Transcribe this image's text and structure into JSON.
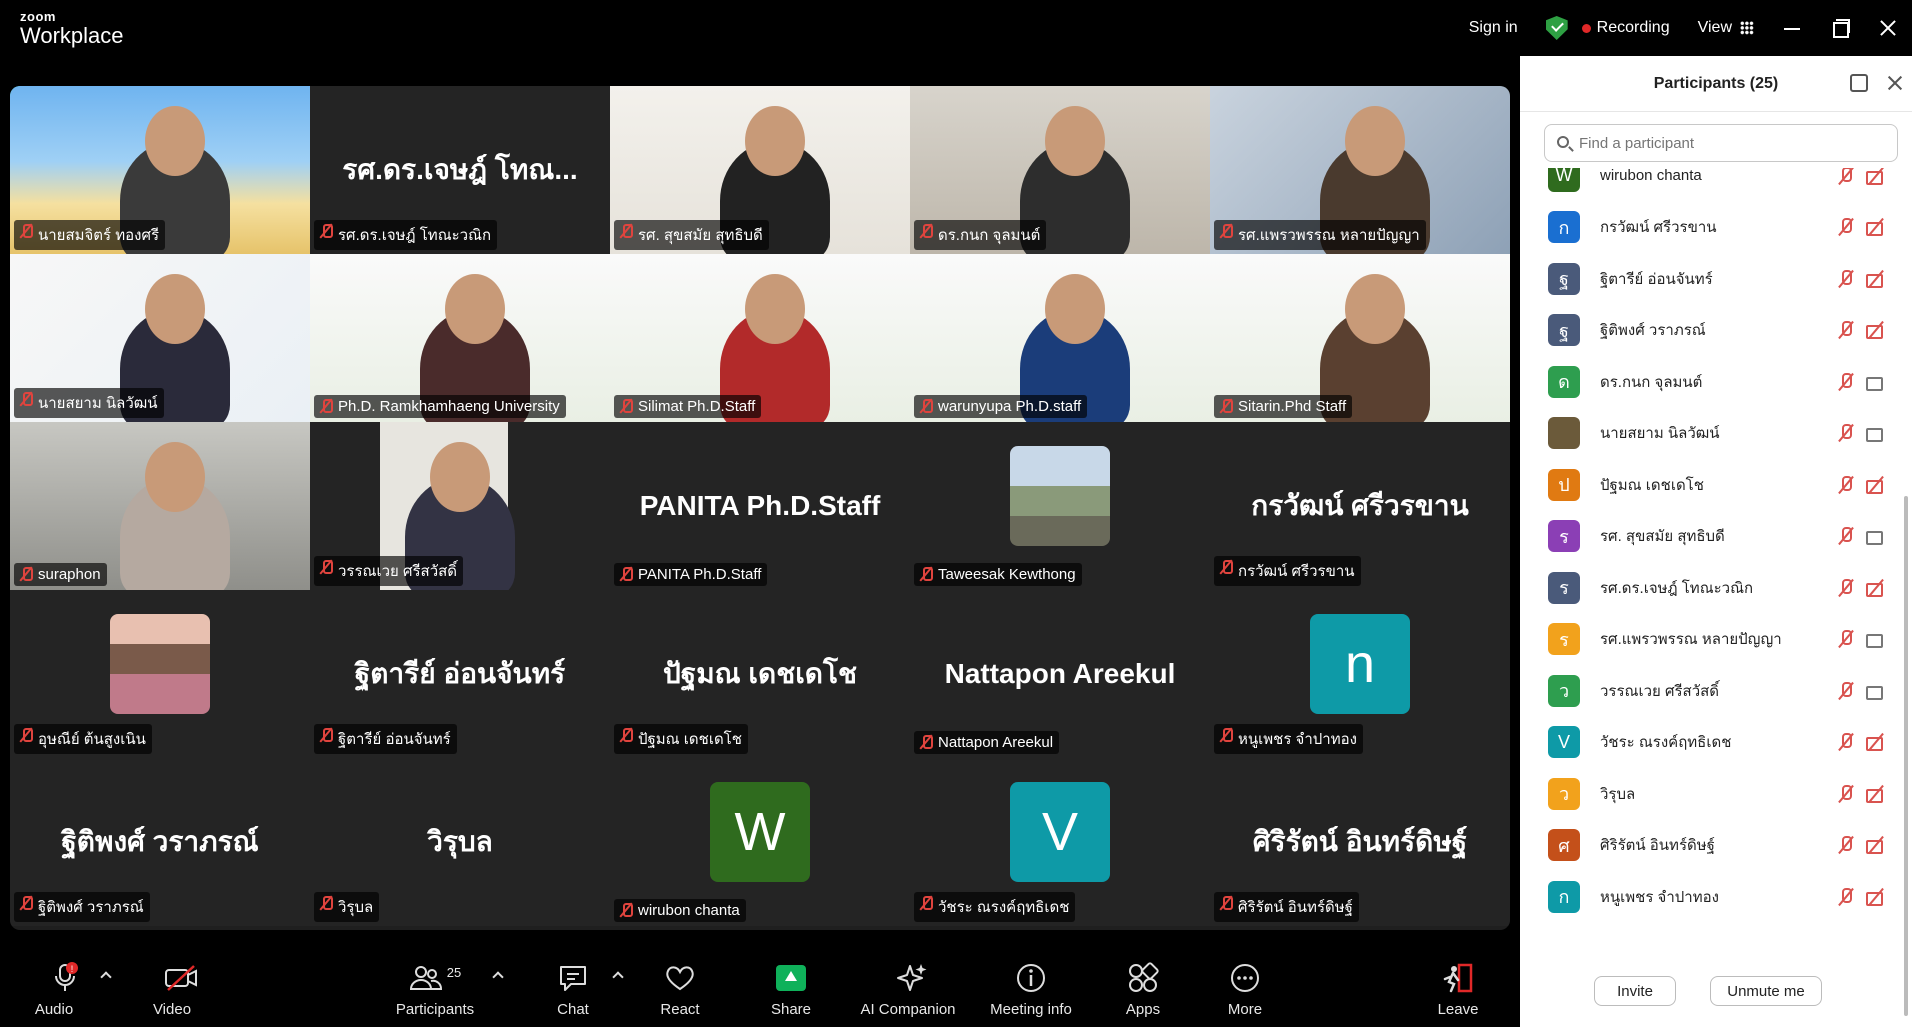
{
  "app": {
    "brand_small": "zoom",
    "brand_name": "Workplace"
  },
  "topbar": {
    "signin": "Sign in",
    "recording": "Recording",
    "view": "View"
  },
  "gallery": {
    "tiles": [
      {
        "name": "นายสมจิตร์ ทองศรี",
        "type": "video",
        "active": true
      },
      {
        "name": "รศ.ดร.เจษฎ์ โทณะวณิก",
        "type": "name",
        "display": "รศ.ดร.เจษฎ์ โทณ..."
      },
      {
        "name": "รศ. สุขสมัย สุทธิบดี",
        "type": "video"
      },
      {
        "name": "ดร.กนก จุลมนต์",
        "type": "video"
      },
      {
        "name": "รศ.แพรวพรรณ หลายปัญญา",
        "type": "video"
      },
      {
        "name": "นายสยาม นิลวัฒน์",
        "type": "video"
      },
      {
        "name": "Ph.D. Ramkhamhaeng University",
        "type": "video"
      },
      {
        "name": "Silimat Ph.D.Staff",
        "type": "video"
      },
      {
        "name": "warunyupa Ph.D.staff",
        "type": "video"
      },
      {
        "name": "Sitarin.Phd Staff",
        "type": "video"
      },
      {
        "name": "suraphon",
        "type": "video"
      },
      {
        "name": "วรรณเวย ศรีสวัสดิ์",
        "type": "video"
      },
      {
        "name": "PANITA Ph.D.Staff",
        "type": "name",
        "display": "PANITA Ph.D.Staff"
      },
      {
        "name": "Taweesak Kewthong",
        "type": "photo"
      },
      {
        "name": "กรวัฒน์ ศรีวรขาน",
        "type": "name",
        "display": "กรวัฒน์ ศรีวรขาน"
      },
      {
        "name": "อุษณีย์ ต้นสูงเนิน",
        "type": "photo"
      },
      {
        "name": "ฐิตารีย์ อ่อนจันทร์",
        "type": "name",
        "display": "ฐิตารีย์ อ่อนจันทร์"
      },
      {
        "name": "ปัฐมณ เดชเดโช",
        "type": "name",
        "display": "ปัฐมณ เดชเดโช"
      },
      {
        "name": "Nattapon Areekul",
        "type": "name",
        "display": "Nattapon Areekul"
      },
      {
        "name": "หนูเพชร จำปาทอง",
        "type": "avatar",
        "letter": "n",
        "color": "#0e9aa7"
      },
      {
        "name": "ฐิติพงศ์ วราภรณ์",
        "type": "name",
        "display": "ฐิติพงศ์ วราภรณ์"
      },
      {
        "name": "วิรุบล",
        "type": "name",
        "display": "วิรุบล"
      },
      {
        "name": "wirubon chanta",
        "type": "avatar",
        "letter": "W",
        "color": "#2f6b1e"
      },
      {
        "name": "วัชระ ณรงค์ฤทธิเดช",
        "type": "avatar",
        "letter": "V",
        "color": "#0e9aa7"
      },
      {
        "name": "ศิริรัตน์ อินทร์ดิษฐ์",
        "type": "name",
        "display": "ศิริรัตน์ อินทร์ดิษฐ์"
      }
    ]
  },
  "toolbar": {
    "audio": "Audio",
    "video": "Video",
    "participants": "Participants",
    "participants_count": "25",
    "chat": "Chat",
    "react": "React",
    "share": "Share",
    "ai": "AI Companion",
    "meeting_info": "Meeting info",
    "apps": "Apps",
    "more": "More",
    "leave": "Leave"
  },
  "panel": {
    "title": "Participants (25)",
    "search_placeholder": "Find a participant",
    "invite": "Invite",
    "unmute": "Unmute me",
    "participants": [
      {
        "name": "wirubon chanta",
        "letter": "W",
        "color": "#2f6b1e",
        "cam": "off"
      },
      {
        "name": "กรวัฒน์ ศรีวรขาน",
        "letter": "ก",
        "color": "#1a6fd1",
        "cam": "off"
      },
      {
        "name": "ฐิตารีย์ อ่อนจันทร์",
        "letter": "ฐ",
        "color": "#4a5a7a",
        "cam": "off"
      },
      {
        "name": "ฐิติพงศ์ วราภรณ์",
        "letter": "ฐ",
        "color": "#4a5a7a",
        "cam": "off"
      },
      {
        "name": "ดร.กนก จุลมนต์",
        "letter": "ด",
        "color": "#2e9e4f",
        "cam": "on"
      },
      {
        "name": "นายสยาม นิลวัฒน์",
        "letter": "",
        "color": "#6b5a3a",
        "cam": "on"
      },
      {
        "name": "ปัฐมณ เดชเดโช",
        "letter": "ป",
        "color": "#e07a12",
        "cam": "off"
      },
      {
        "name": "รศ. สุขสมัย สุทธิบดี",
        "letter": "ร",
        "color": "#8b3fb5",
        "cam": "on"
      },
      {
        "name": "รศ.ดร.เจษฎ์ โทณะวณิก",
        "letter": "ร",
        "color": "#4a5a7a",
        "cam": "off"
      },
      {
        "name": "รศ.แพรวพรรณ หลายปัญญา",
        "letter": "ร",
        "color": "#f2a21c",
        "cam": "on"
      },
      {
        "name": "วรรณเวย ศรีสวัสดิ์",
        "letter": "ว",
        "color": "#2e9e4f",
        "cam": "on"
      },
      {
        "name": "วัชระ ณรงค์ฤทธิเดช",
        "letter": "V",
        "color": "#0e9aa7",
        "cam": "off"
      },
      {
        "name": "วิรุบล",
        "letter": "ว",
        "color": "#f2a21c",
        "cam": "off"
      },
      {
        "name": "ศิริรัตน์ อินทร์ดิษฐ์",
        "letter": "ศ",
        "color": "#c4501a",
        "cam": "off"
      },
      {
        "name": "หนูเพชร จำปาทอง",
        "letter": "ก",
        "color": "#0e9aa7",
        "cam": "off"
      },
      {
        "name": "อุษณีย์ ต้นสูงเนิน",
        "letter": "",
        "color": "#a05a6a",
        "cam": "off"
      }
    ]
  }
}
